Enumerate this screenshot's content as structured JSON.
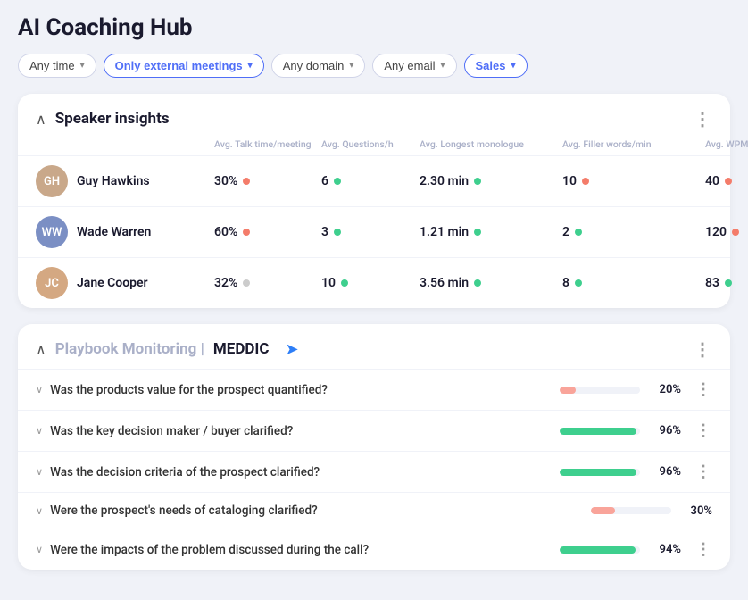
{
  "app": {
    "title": "AI Coaching Hub"
  },
  "filters": [
    {
      "id": "time",
      "label": "Any time",
      "active": false
    },
    {
      "id": "meetings",
      "label": "Only external meetings",
      "active": true
    },
    {
      "id": "domain",
      "label": "Any domain",
      "active": false
    },
    {
      "id": "email",
      "label": "Any email",
      "active": false
    },
    {
      "id": "sales",
      "label": "Sales",
      "active": true
    }
  ],
  "speakerInsights": {
    "title": "Speaker insights",
    "columns": [
      "",
      "Avg. Talk time/meeting",
      "Avg. Questions/h",
      "Avg. Longest monologue",
      "Avg. Filler words/min",
      "Avg. WPM"
    ],
    "speakers": [
      {
        "name": "Guy Hawkins",
        "initials": "GH",
        "bgColor": "#e8d5c4",
        "metrics": [
          {
            "value": "30%",
            "dotColor": "red"
          },
          {
            "value": "6",
            "dotColor": "green"
          },
          {
            "value": "2.30 min",
            "dotColor": "green"
          },
          {
            "value": "10",
            "dotColor": "red"
          },
          {
            "value": "40",
            "dotColor": "red"
          }
        ]
      },
      {
        "name": "Wade Warren",
        "initials": "WW",
        "bgColor": "#cfd8f0",
        "metrics": [
          {
            "value": "60%",
            "dotColor": "red"
          },
          {
            "value": "3",
            "dotColor": "green"
          },
          {
            "value": "1.21 min",
            "dotColor": "green"
          },
          {
            "value": "2",
            "dotColor": "green"
          },
          {
            "value": "120",
            "dotColor": "red"
          }
        ]
      },
      {
        "name": "Jane Cooper",
        "initials": "JC",
        "bgColor": "#f0ddd0",
        "metrics": [
          {
            "value": "32%",
            "dotColor": "gray"
          },
          {
            "value": "10",
            "dotColor": "green"
          },
          {
            "value": "3.56 min",
            "dotColor": "green"
          },
          {
            "value": "8",
            "dotColor": "green"
          },
          {
            "value": "83",
            "dotColor": "green"
          }
        ]
      }
    ]
  },
  "playbook": {
    "titleMuted": "Playbook Monitoring | ",
    "titleHighlight": "MEDDIC",
    "items": [
      {
        "question": "Was the products value for the prospect quantified?",
        "percent": 20,
        "pctLabel": "20%",
        "fillColor": "salmon",
        "hasMore": true
      },
      {
        "question": "Was the key decision maker / buyer clarified?",
        "percent": 96,
        "pctLabel": "96%",
        "fillColor": "green",
        "hasMore": true
      },
      {
        "question": "Was the decision criteria of the prospect clarified?",
        "percent": 96,
        "pctLabel": "96%",
        "fillColor": "green",
        "hasMore": true
      },
      {
        "question": "Were the prospect's needs of cataloging clarified?",
        "percent": 30,
        "pctLabel": "30%",
        "fillColor": "salmon",
        "hasMore": false
      },
      {
        "question": "Were the impacts of the problem discussed during the call?",
        "percent": 94,
        "pctLabel": "94%",
        "fillColor": "green",
        "hasMore": true
      }
    ]
  }
}
